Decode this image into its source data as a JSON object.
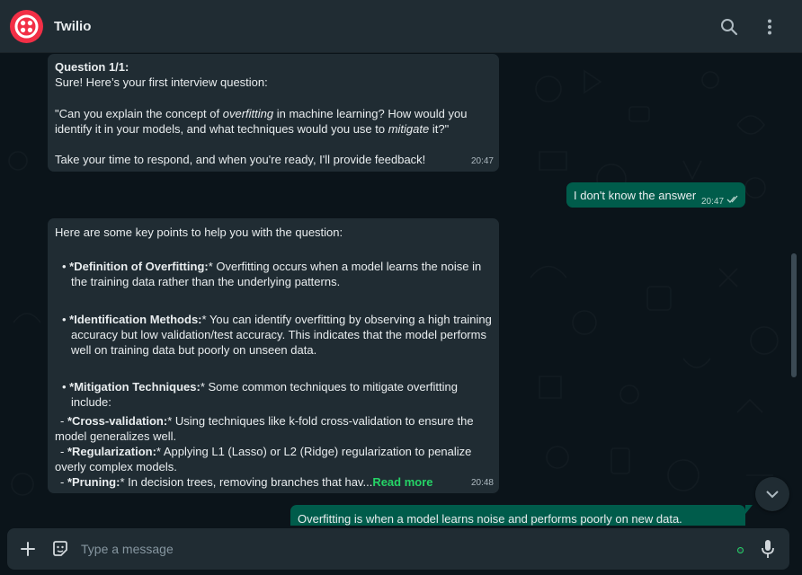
{
  "header": {
    "contact_name": "Twilio"
  },
  "messages": {
    "m1": {
      "title": "Question 1/1:",
      "l1": "Sure! Here’s your first interview question:",
      "l2a": "\"Can you explain the concept of ",
      "l2b": "overfitting",
      "l2c": " in machine learning? How would you",
      "l3a": "identify it in your models, and what techniques would you use to ",
      "l3b": "mitigate",
      "l3c": " it?\"",
      "l4": "Take your time to respond, and when you're ready, I'll provide feedback!",
      "time": "20:47"
    },
    "m2": {
      "text": "I don't know the answer",
      "time": "20:47"
    },
    "m3": {
      "intro": "Here are some key points to help you with the question:",
      "p1b": "*Definition of Overfitting:",
      "p1t": "* Overfitting occurs when a model learns the noise in",
      "p1c": "the training data rather than the underlying patterns.",
      "p2b": "*Identification Methods:",
      "p2t": "* You can identify overfitting by observing a high training",
      "p2c1": "accuracy but low validation/test accuracy. This indicates that the model performs",
      "p2c2": "well on training data but poorly on unseen data.",
      "p3b": "*Mitigation Techniques:",
      "p3t": "* Some common techniques to mitigate overfitting",
      "p3c": "include:",
      "s1pre": "- ",
      "s1b": "*Cross-validation:",
      "s1t": "* Using techniques like k-fold cross-validation to ensure the",
      "s1c": "model generalizes well.",
      "s2pre": "- ",
      "s2b": "*Regularization:",
      "s2t": "* Applying L1 (Lasso) or L2 (Ridge) regularization to penalize",
      "s2c": "overly complex models.",
      "s3pre": "- ",
      "s3b": "*Pruning:",
      "s3t": "* In decision trees, removing branches that hav...",
      "read_more": "Read more",
      "time": "20:48"
    },
    "m4": {
      "text": "Overfitting is when a model learns noise and performs poorly on new data."
    }
  },
  "composer": {
    "placeholder": "Type a message"
  },
  "icons": {
    "search": "search-icon",
    "menu": "more-vertical-icon",
    "attach": "plus-icon",
    "emoji": "sticker-icon",
    "mic": "microphone-icon",
    "scroll": "chevron-down-icon",
    "read": "double-check-icon"
  },
  "colors": {
    "brand": "#f22f46",
    "outgoing": "#005c4b",
    "incoming": "#202c33",
    "link": "#25d366"
  }
}
